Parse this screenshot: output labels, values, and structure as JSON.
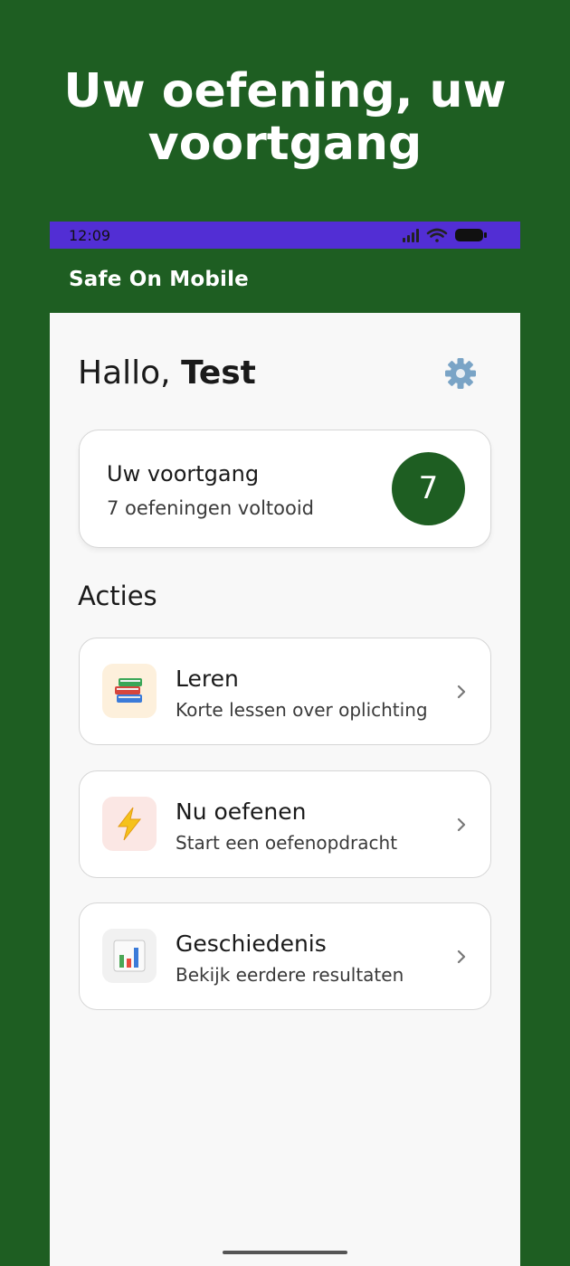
{
  "promo": {
    "headline_line1": "Uw oefening, uw",
    "headline_line2": "voortgang"
  },
  "status_bar": {
    "time": "12:09",
    "bg_color": "#522ed4"
  },
  "app_bar": {
    "title": "Safe On Mobile"
  },
  "greeting": {
    "prefix": "Hallo,",
    "name": "Test"
  },
  "settings": {
    "icon": "gear-icon"
  },
  "progress": {
    "title": "Uw voortgang",
    "subtitle": "7 oefeningen voltooid",
    "count": "7"
  },
  "actions": {
    "section_title": "Acties",
    "items": [
      {
        "title": "Leren",
        "subtitle": "Korte lessen over oplichting",
        "icon": "books-icon",
        "icon_bg": "#fdf0dc"
      },
      {
        "title": "Nu oefenen",
        "subtitle": "Start een oefenopdracht",
        "icon": "lightning-icon",
        "icon_bg": "#fbe7e4"
      },
      {
        "title": "Geschiedenis",
        "subtitle": "Bekijk eerdere resultaten",
        "icon": "bar-chart-icon",
        "icon_bg": "#f1f1f1"
      }
    ]
  },
  "colors": {
    "brand_green": "#1e5e22",
    "background": "#f8f8f8"
  }
}
